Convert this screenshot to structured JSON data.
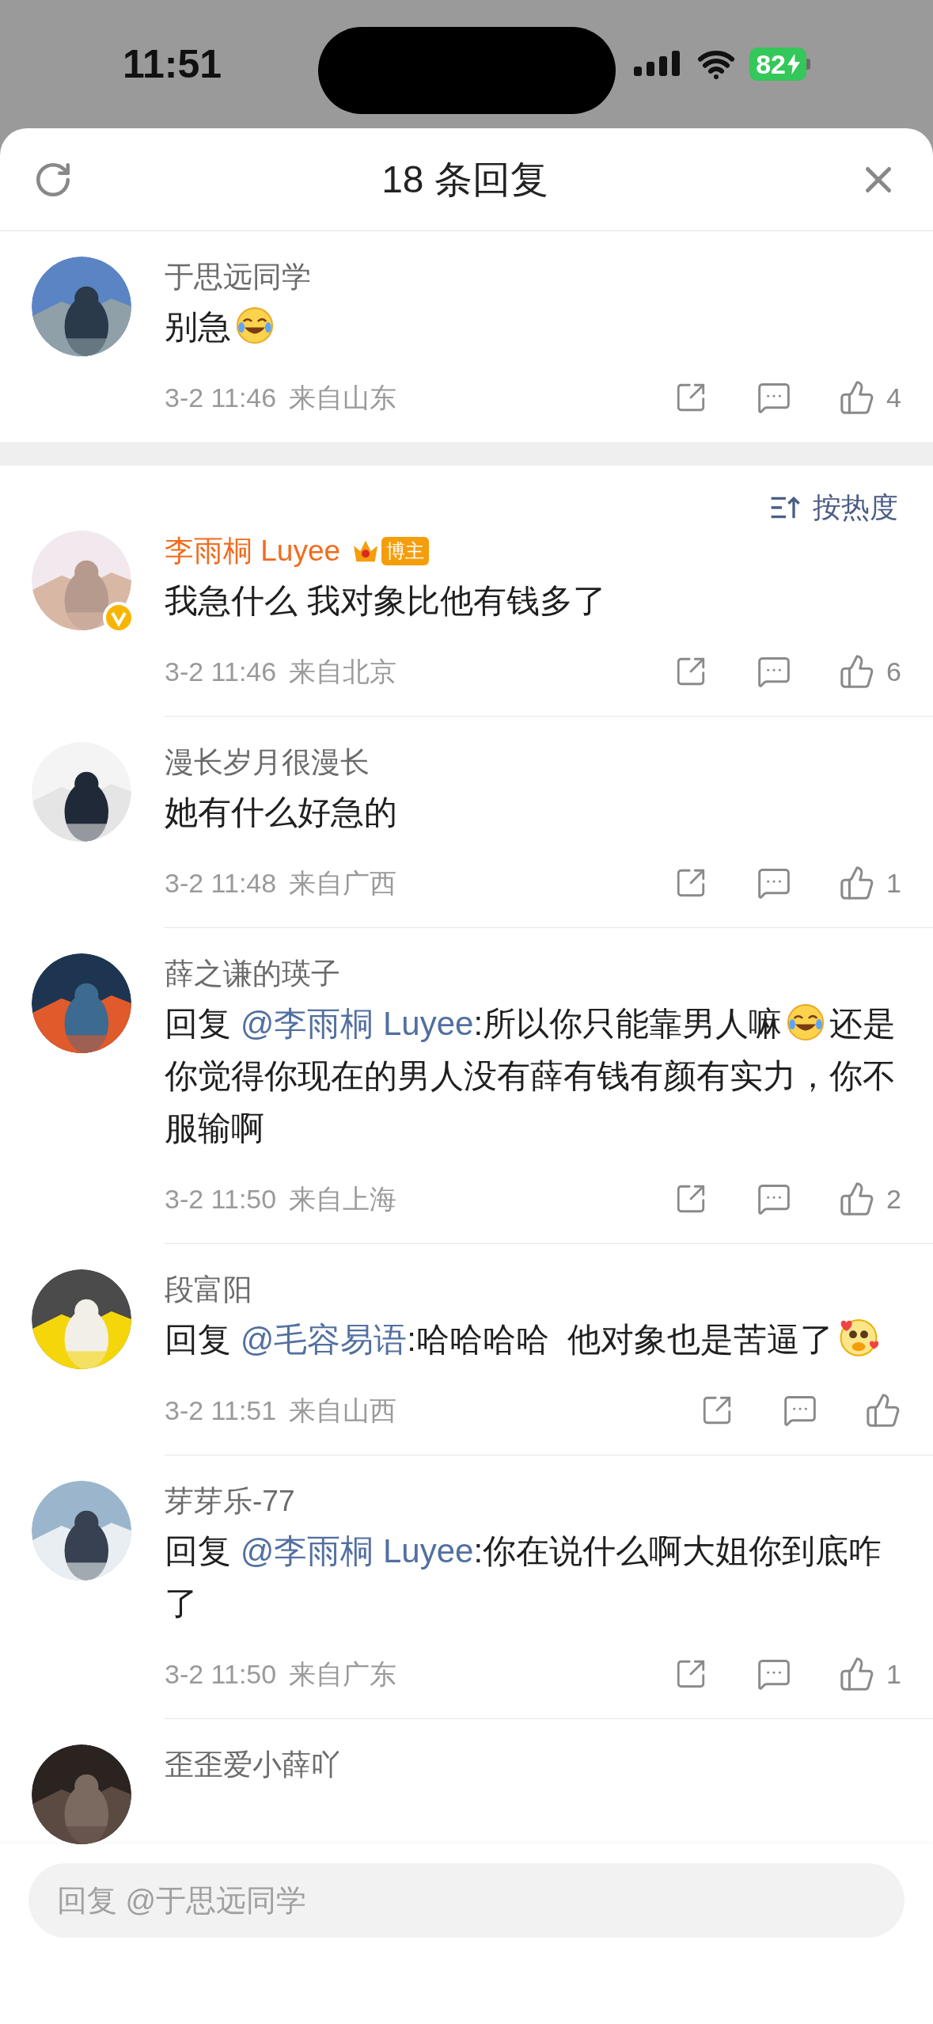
{
  "status_bar": {
    "time": "11:51",
    "battery": "82"
  },
  "sheet": {
    "title": "18 条回复"
  },
  "root_comment": {
    "name": "于思远同学",
    "member": false,
    "verified": false,
    "content": [
      {
        "kind": "text",
        "text": "别急"
      },
      {
        "kind": "emoji_laugh_cry"
      }
    ],
    "time": "3-2 11:46",
    "location": "来自山东",
    "likes": "4"
  },
  "sort": {
    "label": "按热度"
  },
  "replies": [
    {
      "name": "李雨桐 Luyee",
      "member": true,
      "verified": true,
      "badge": "博主",
      "content": [
        {
          "kind": "text",
          "text": "我急什么 我对象比他有钱多了"
        }
      ],
      "time": "3-2 11:46",
      "location": "来自北京",
      "likes": "6"
    },
    {
      "name": "漫长岁月很漫长",
      "member": false,
      "verified": false,
      "content": [
        {
          "kind": "text",
          "text": "她有什么好急的"
        }
      ],
      "time": "3-2 11:48",
      "location": "来自广西",
      "likes": "1"
    },
    {
      "name": "薛之谦的瑛子",
      "member": false,
      "verified": false,
      "content": [
        {
          "kind": "text",
          "text": "回复 "
        },
        {
          "kind": "mention",
          "text": "@李雨桐 Luyee"
        },
        {
          "kind": "text",
          "text": ":所以你只能靠男人嘛"
        },
        {
          "kind": "emoji_laugh_cry"
        },
        {
          "kind": "text",
          "text": "还是你觉得你现在的男人没有薛有钱有颜有实力，你不服输啊"
        }
      ],
      "time": "3-2 11:50",
      "location": "来自上海",
      "likes": "2"
    },
    {
      "name": "段富阳",
      "member": false,
      "verified": false,
      "content": [
        {
          "kind": "text",
          "text": "回复 "
        },
        {
          "kind": "mention",
          "text": "@毛容易语"
        },
        {
          "kind": "text",
          "text": ":哈哈哈哈  他对象也是苦逼了"
        },
        {
          "kind": "emoji_shy"
        }
      ],
      "time": "3-2 11:51",
      "location": "来自山西"
    },
    {
      "name": "芽芽乐-77",
      "member": false,
      "verified": false,
      "content": [
        {
          "kind": "text",
          "text": "回复 "
        },
        {
          "kind": "mention",
          "text": "@李雨桐 Luyee"
        },
        {
          "kind": "text",
          "text": ":你在说什么啊大姐你到底咋了"
        }
      ],
      "time": "3-2 11:50",
      "location": "来自广东",
      "likes": "1"
    },
    {
      "name": "歪歪爱小薛吖",
      "member": false,
      "verified": false
    }
  ],
  "reply_bar": {
    "placeholder": "回复 @于思远同学"
  }
}
